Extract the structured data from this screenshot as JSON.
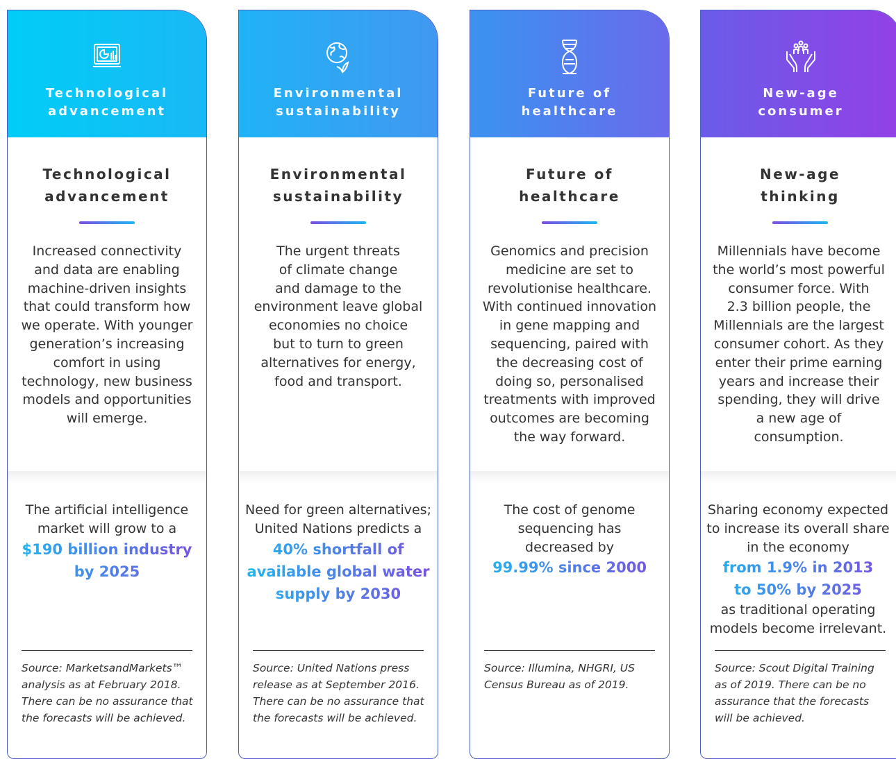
{
  "cards": [
    {
      "icon": "chart-monitor-icon",
      "header_line1": "Technological",
      "header_line2": "advancement",
      "title_line1": "Technological",
      "title_line2": "advancement",
      "desc_lines": [
        "Increased connectivity",
        "and data are enabling",
        "machine-driven insights",
        "that could transform how",
        "we operate. With younger",
        "generation’s increasing",
        "comfort in using",
        "technology, new business",
        "models and opportunities",
        "will emerge."
      ],
      "stat_before": [
        "The artificial intelligence",
        "market will grow to a"
      ],
      "stat_highlight": [
        "$190 billion industry",
        "by 2025"
      ],
      "stat_after": [],
      "source_lines": [
        "Source: MarketsandMarkets™",
        "analysis as at February 2018.",
        "There can be no assurance that",
        "the forecasts will be achieved."
      ]
    },
    {
      "icon": "globe-plant-icon",
      "header_line1": "Environmental",
      "header_line2": "sustainability",
      "title_line1": "Environmental",
      "title_line2": "sustainability",
      "desc_lines": [
        "The urgent threats",
        "of climate change",
        "and damage to the",
        "environment leave global",
        "economies no choice",
        "but to turn to green",
        "alternatives for energy,",
        "food and transport."
      ],
      "stat_before": [
        "Need for green alternatives;",
        "United Nations predicts a"
      ],
      "stat_highlight": [
        "40% shortfall of",
        "available global water",
        "supply by 2030"
      ],
      "stat_after": [],
      "source_lines": [
        "Source: United Nations press",
        "release as at September 2016.",
        "There can be no assurance that",
        "the forecasts will be achieved."
      ]
    },
    {
      "icon": "dna-icon",
      "header_line1": "Future of",
      "header_line2": "healthcare",
      "title_line1": "Future of",
      "title_line2": "healthcare",
      "desc_lines": [
        "Genomics and precision",
        "medicine are set to",
        "revolutionise healthcare.",
        "With continued innovation",
        "in gene mapping and",
        "sequencing, paired with",
        "the decreasing cost of",
        "doing so, personalised",
        "treatments with improved",
        "outcomes are becoming",
        "the way forward."
      ],
      "stat_before": [
        "The cost of genome",
        "sequencing has",
        "decreased by"
      ],
      "stat_highlight": [
        "99.99% since 2000"
      ],
      "stat_after": [],
      "source_lines": [
        "Source: Illumina, NHGRI, US",
        "Census Bureau as of 2019."
      ]
    },
    {
      "icon": "hands-people-icon",
      "header_line1": "New-age",
      "header_line2": "consumer",
      "title_line1": "New-age",
      "title_line2": "thinking",
      "desc_lines": [
        "Millennials have become",
        "the world’s most powerful",
        "consumer force. With",
        "2.3 billion people, the",
        "Millennials are the largest",
        "consumer cohort. As they",
        "enter their prime earning",
        "years and increase their",
        "spending, they will drive",
        "a new age of",
        "consumption."
      ],
      "stat_before": [
        "Sharing economy expected",
        "to increase its overall share",
        "in the economy"
      ],
      "stat_highlight": [
        "from 1.9% in 2013",
        "to 50% by 2025"
      ],
      "stat_after": [
        "as traditional operating",
        "models become irrelevant."
      ],
      "source_lines": [
        "Source: Scout Digital Training",
        "as of 2019. There can be no",
        "assurance that the forecasts",
        "will be achieved."
      ]
    }
  ]
}
